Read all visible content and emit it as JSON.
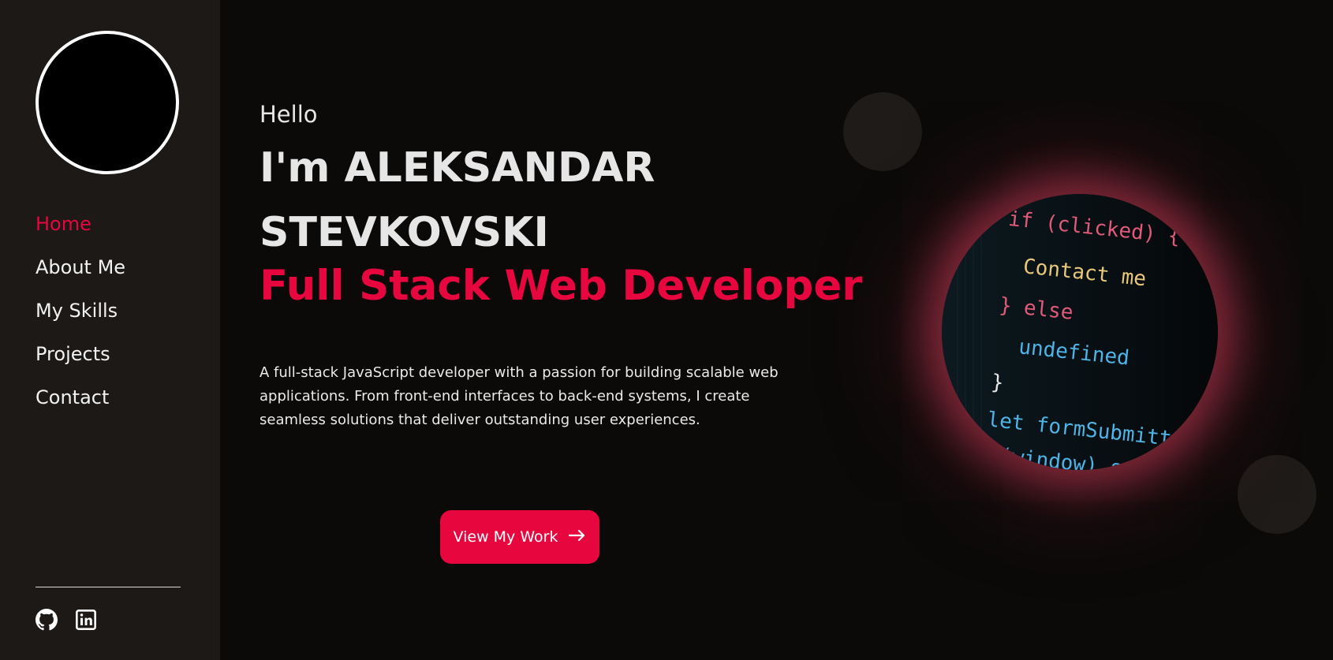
{
  "sidebar": {
    "nav": [
      {
        "label": "Home",
        "active": true
      },
      {
        "label": "About Me",
        "active": false
      },
      {
        "label": "My Skills",
        "active": false
      },
      {
        "label": "Projects",
        "active": false
      },
      {
        "label": "Contact",
        "active": false
      }
    ],
    "social": [
      {
        "icon": "github-icon"
      },
      {
        "icon": "linkedin-icon"
      }
    ]
  },
  "hero": {
    "greeting": "Hello",
    "name": "I'm ALEKSANDAR STEVKOVSKI",
    "role": "Full Stack Web Developer",
    "description": "A full-stack JavaScript developer with a passion for building scalable web applications. From front-end interfaces to back-end systems, I create seamless solutions that deliver outstanding user experiences.",
    "cta_label": "View My Work"
  },
  "code_image": {
    "lines": [
      "if (clicked) {",
      "Contact me",
      "} else",
      "undefined",
      "}",
      "let formSubmitted = false;",
      "(window).scroll"
    ]
  },
  "colors": {
    "accent": "#e8063f",
    "sidebar_bg": "#1c1917",
    "page_bg": "#0b0a09",
    "text": "#e6e6e6"
  }
}
